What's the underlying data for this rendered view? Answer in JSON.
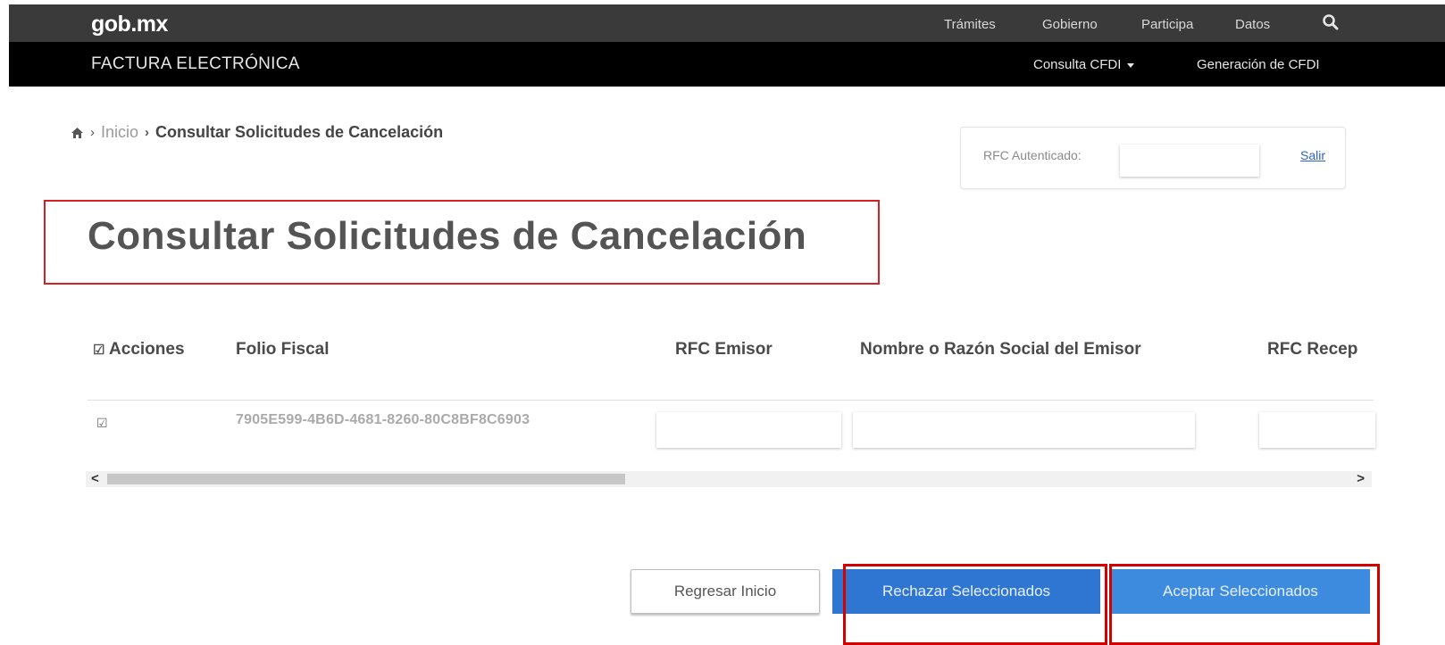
{
  "header": {
    "logo": "gob.mx",
    "nav": [
      "Trámites",
      "Gobierno",
      "Participa",
      "Datos"
    ],
    "search_icon": "search-icon",
    "site_title": "FACTURA ELECTRÓNICA",
    "menu": {
      "consulta": "Consulta CFDI",
      "generacion": "Generación de CFDI"
    }
  },
  "breadcrumb": {
    "home_icon": "home-icon",
    "inicio": "Inicio",
    "current": "Consultar Solicitudes de Cancelación"
  },
  "auth": {
    "label": "RFC Autenticado:",
    "value": "",
    "logout": "Salir"
  },
  "page_title": "Consultar Solicitudes de Cancelación",
  "table": {
    "headers": {
      "acciones": "Acciones",
      "folio": "Folio Fiscal",
      "rfc_emisor": "RFC Emisor",
      "nombre_emisor": "Nombre o Razón Social del Emisor",
      "rfc_receptor": "RFC Recep"
    },
    "rows": [
      {
        "checked": true,
        "folio": "7905E599-4B6D-4681-8260-80C8BF8C6903",
        "rfc_emisor": "",
        "nombre_emisor": "",
        "rfc_receptor": ""
      }
    ]
  },
  "scroll": {
    "left": "<",
    "right": ">"
  },
  "buttons": {
    "back": "Regresar Inicio",
    "reject": "Rechazar Seleccionados",
    "accept": "Aceptar Seleccionados"
  },
  "colors": {
    "topbar": "#3a3a3a",
    "subbar": "#000000",
    "primary_button": "#2f76d2",
    "highlight": "#d40000"
  }
}
